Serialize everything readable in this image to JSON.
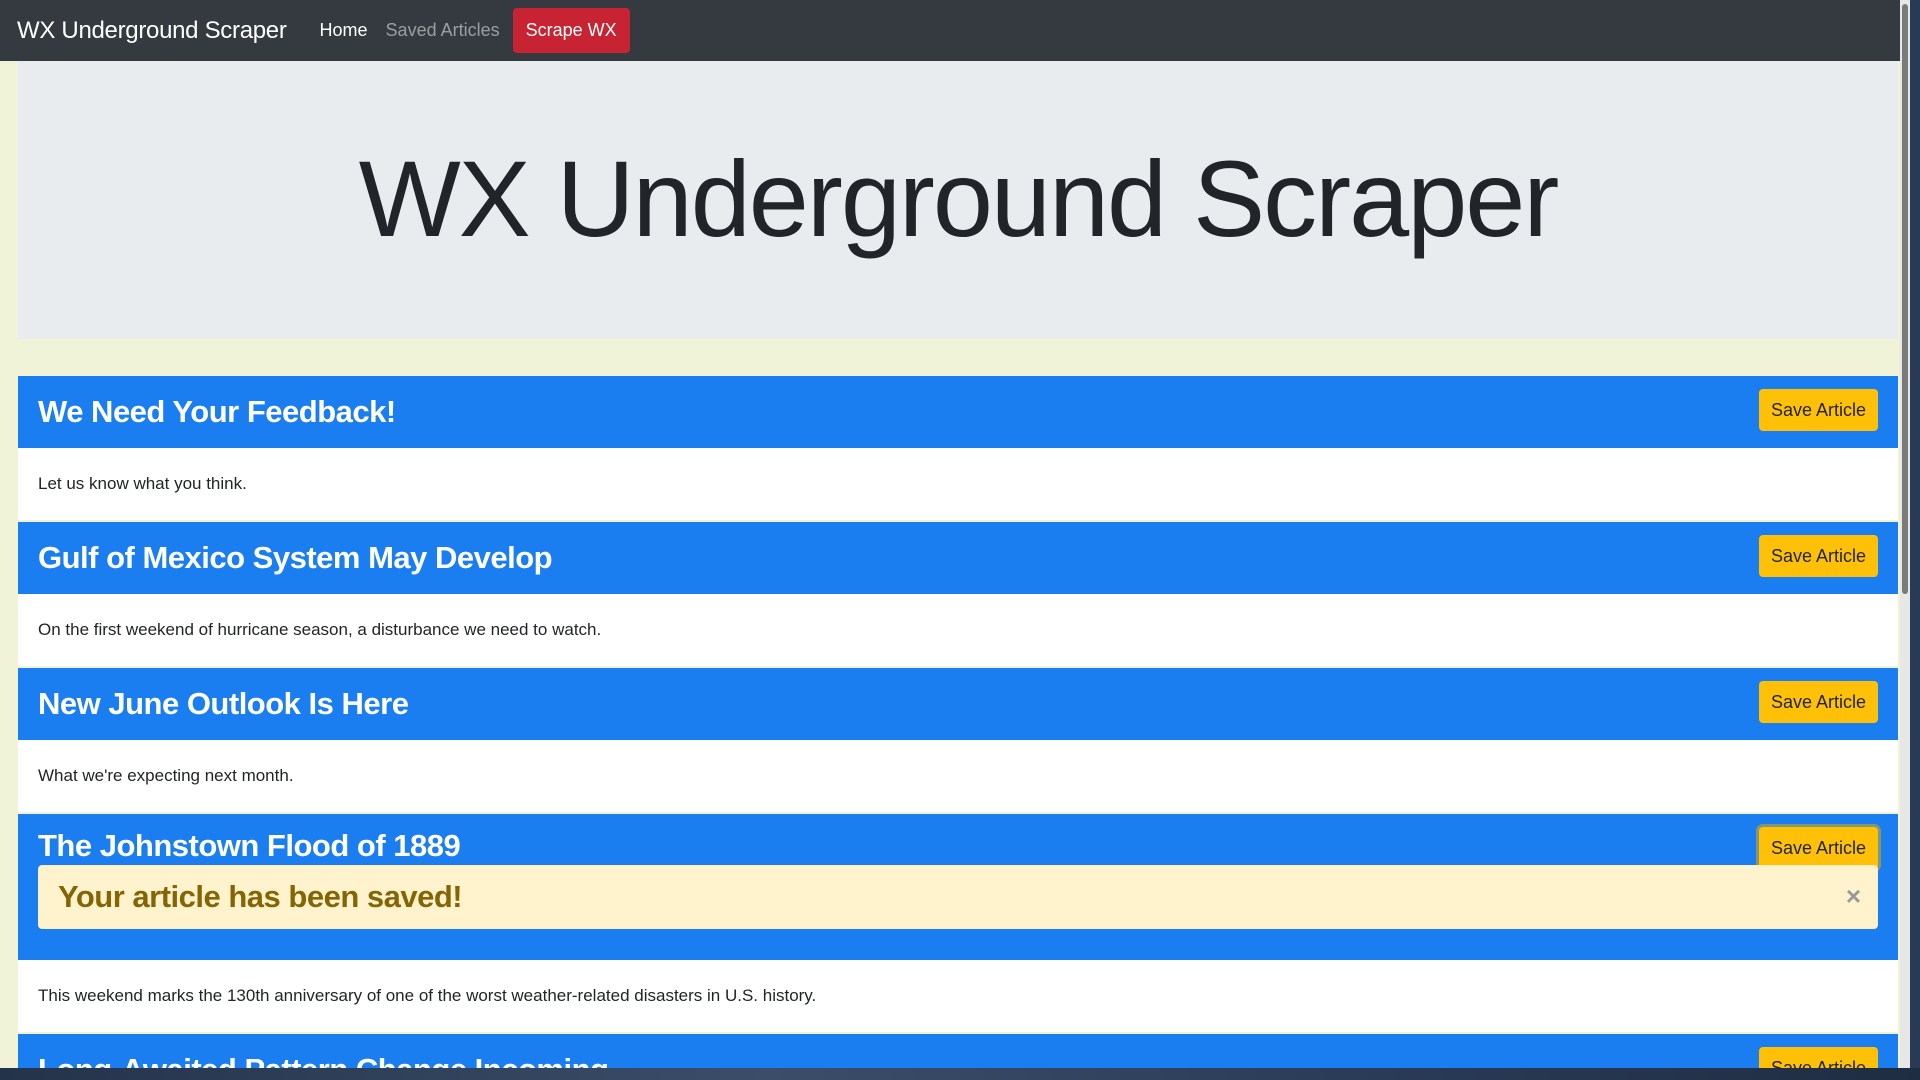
{
  "navbar": {
    "brand": "WX Underground Scraper",
    "links": [
      {
        "label": "Home",
        "active": true
      },
      {
        "label": "Saved Articles",
        "active": false
      }
    ],
    "scrape_button": "Scrape WX"
  },
  "jumbotron": {
    "title": "WX Underground Scraper"
  },
  "articles": [
    {
      "title": "We Need Your Feedback!",
      "summary": "Let us know what you think.",
      "save_label": "Save Article"
    },
    {
      "title": "Gulf of Mexico System May Develop",
      "summary": "On the first weekend of hurricane season, a disturbance we need to watch.",
      "save_label": "Save Article"
    },
    {
      "title": "New June Outlook Is Here",
      "summary": "What we're expecting next month.",
      "save_label": "Save Article"
    },
    {
      "title": "The Johnstown Flood of 1889",
      "summary": "This weekend marks the 130th anniversary of one of the worst weather-related disasters in U.S. history.",
      "save_label": "Save Article"
    },
    {
      "title": "Long-Awaited Pattern Change Incoming",
      "summary": "",
      "save_label": "Save Article"
    }
  ],
  "alert": {
    "message": "Your article has been saved!",
    "close": "×"
  },
  "colors": {
    "navbar": "#343a40",
    "scrape_button": "#c82333",
    "card_header": "#1a7ef0",
    "save_button": "#ffc107",
    "alert_bg": "#fff3cd",
    "alert_text": "#856404",
    "page_bg": "#f1f3d9"
  }
}
